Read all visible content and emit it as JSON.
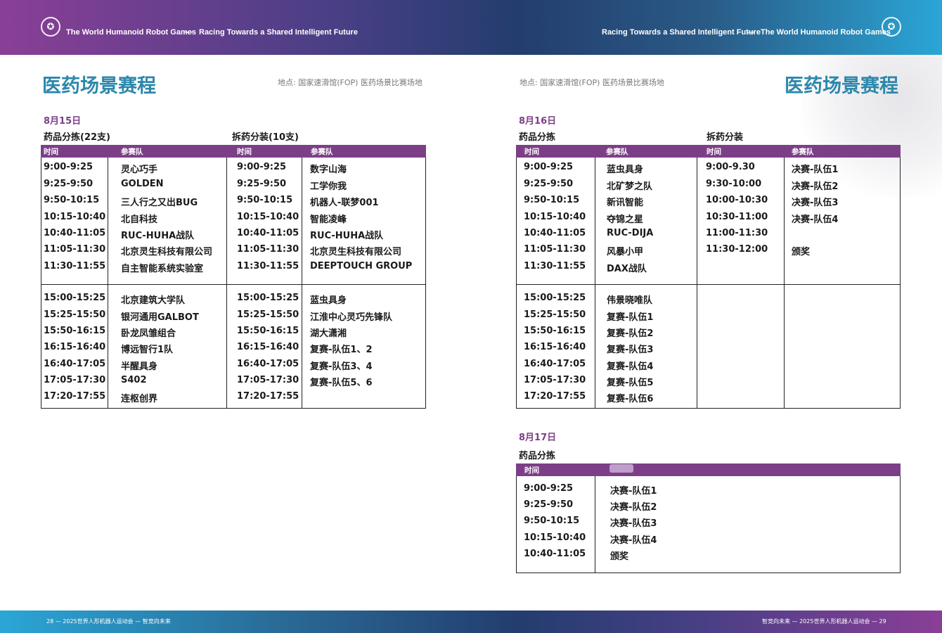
{
  "banner": {
    "left_title": "The World Humanoid Robot Games",
    "left_dash": "—",
    "left_slogan": "Racing Towards a Shared Intelligent Future",
    "right_slogan": "Racing Towards a Shared Intelligent Future",
    "right_dash": "—",
    "right_title": "The World Humanoid Robot Games"
  },
  "footer": {
    "left": "28 — 2025世界人形机器人运动会 — 智竞向未来",
    "right": "智竞向未来 — 2025世界人形机器人运动会 — 29"
  },
  "left_page": {
    "title": "医药场景赛程",
    "venue": "地点: 国家速滑馆(FOP) 医药场景比赛场地",
    "date": "8月15日",
    "sections": [
      "药品分拣(22支)",
      "拆药分装(10支)"
    ],
    "headers": [
      "时间",
      "参赛队",
      "时间",
      "参赛队"
    ],
    "rows": [
      [
        "9:00-9:25",
        "灵心巧手",
        "9:00-9:25",
        "数字山海"
      ],
      [
        "9:25-9:50",
        "GOLDEN",
        "9:25-9:50",
        "工学你我"
      ],
      [
        "9:50-10:15",
        "三人行之又出BUG",
        "9:50-10:15",
        "机器人-联梦001"
      ],
      [
        "10:15-10:40",
        "北自科技",
        "10:15-10:40",
        "智能凌峰"
      ],
      [
        "10:40-11:05",
        "RUC-HUHA战队",
        "10:40-11:05",
        "RUC-HUHA战队"
      ],
      [
        "11:05-11:30",
        "北京灵生科技有限公司",
        "11:05-11:30",
        "北京灵生科技有限公司"
      ],
      [
        "11:30-11:55",
        "自主智能系统实验室",
        "11:30-11:55",
        "DEEPTOUCH GROUP"
      ],
      [
        "15:00-15:25",
        "北京建筑大学队",
        "15:00-15:25",
        "蓝虫具身"
      ],
      [
        "15:25-15:50",
        "银河通用GALBOT",
        "15:25-15:50",
        "江淮中心灵巧先锋队"
      ],
      [
        "15:50-16:15",
        "卧龙凤雏组合",
        "15:50-16:15",
        "湖大潇湘"
      ],
      [
        "16:15-16:40",
        "博远智行1队",
        "16:15-16:40",
        "复赛-队伍1、2"
      ],
      [
        "16:40-17:05",
        "半醒具身",
        "16:40-17:05",
        "复赛-队伍3、4"
      ],
      [
        "17:05-17:30",
        "S402",
        "17:05-17:30",
        "复赛-队伍5、6"
      ],
      [
        "17:20-17:55",
        "连枢创界",
        "17:20-17:55",
        ""
      ]
    ]
  },
  "right_page": {
    "title": "医药场景赛程",
    "venue": "地点: 国家速滑馆(FOP) 医药场景比赛场地",
    "day16": {
      "date": "8月16日",
      "sections": [
        "药品分拣",
        "拆药分装"
      ],
      "headers": [
        "时间",
        "参赛队",
        "时间",
        "参赛队"
      ],
      "rows": [
        [
          "9:00-9:25",
          "蓝虫具身",
          "9:00-9.30",
          "决赛-队伍1"
        ],
        [
          "9:25-9:50",
          "北矿梦之队",
          "9:30-10:00",
          "决赛-队伍2"
        ],
        [
          "9:50-10:15",
          "新讯智能",
          "10:00-10:30",
          "决赛-队伍3"
        ],
        [
          "10:15-10:40",
          "夺锦之星",
          "10:30-11:00",
          "决赛-队伍4"
        ],
        [
          "10:40-11:05",
          "RUC-DIJA",
          "11:00-11:30",
          ""
        ],
        [
          "11:05-11:30",
          "风暴小甲",
          "11:30-12:00",
          "颁奖"
        ],
        [
          "11:30-11:55",
          "DAX战队",
          "",
          ""
        ],
        [
          "15:00-15:25",
          "伟景晓唯队",
          "",
          ""
        ],
        [
          "15:25-15:50",
          "复赛-队伍1",
          "",
          ""
        ],
        [
          "15:50-16:15",
          "复赛-队伍2",
          "",
          ""
        ],
        [
          "16:15-16:40",
          "复赛-队伍3",
          "",
          ""
        ],
        [
          "16:40-17:05",
          "复赛-队伍4",
          "",
          ""
        ],
        [
          "17:05-17:30",
          "复赛-队伍5",
          "",
          ""
        ],
        [
          "17:20-17:55",
          "复赛-队伍6",
          "",
          ""
        ]
      ]
    },
    "day17": {
      "date": "8月17日",
      "section": "药品分拣",
      "headers": [
        "时间"
      ],
      "rows": [
        [
          "9:00-9:25",
          "决赛-队伍1"
        ],
        [
          "9:25-9:50",
          "决赛-队伍2"
        ],
        [
          "9:50-10:15",
          "决赛-队伍3"
        ],
        [
          "10:15-10:40",
          "决赛-队伍4"
        ],
        [
          "10:40-11:05",
          "颁奖"
        ]
      ]
    }
  }
}
